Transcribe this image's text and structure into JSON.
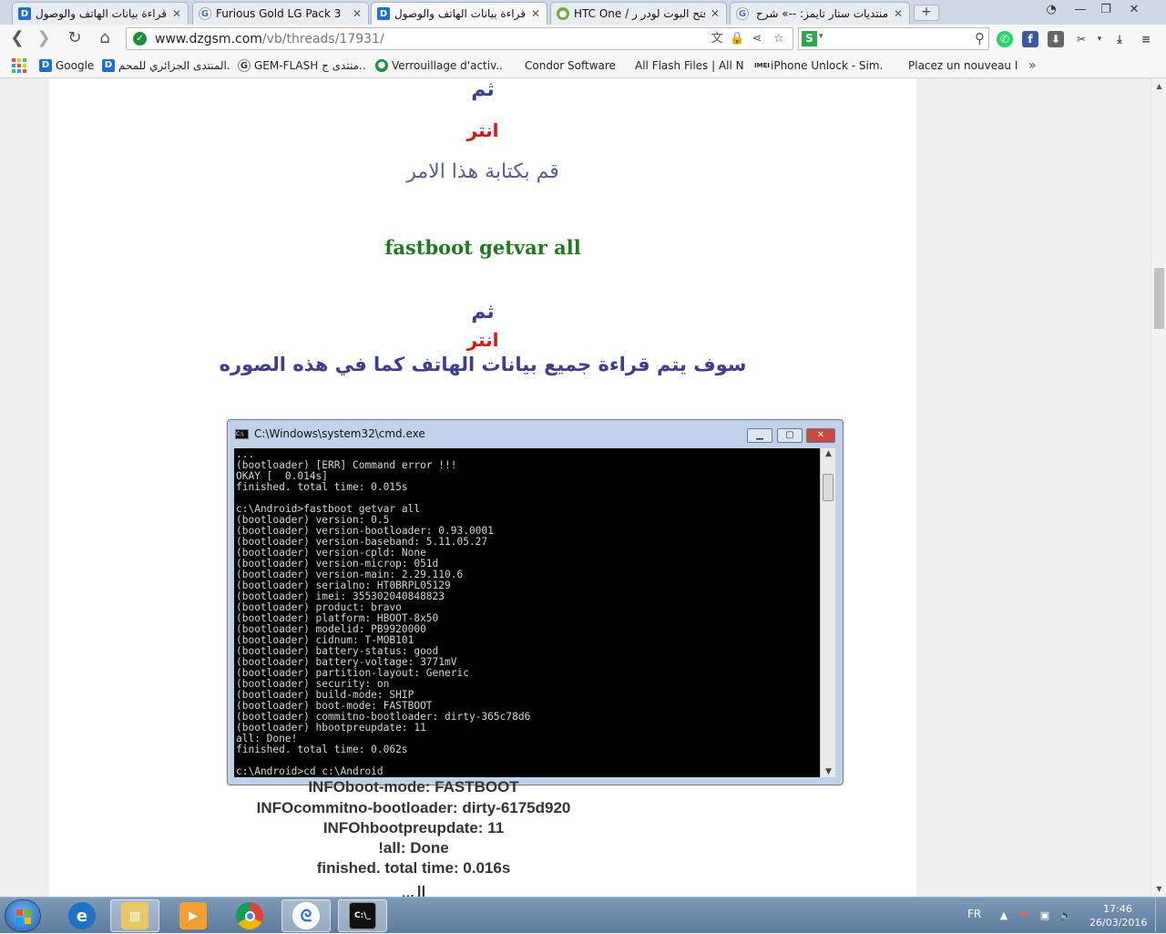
{
  "browser": {
    "tabs": [
      {
        "title": "قراءة بيانات الهاتف والوصول ل",
        "icon": "dzgsm-favicon"
      },
      {
        "title": "Furious Gold LG Pack 3",
        "icon": "gemflash-favicon"
      },
      {
        "title": "قراءة بيانات الهاتف والوصول ل",
        "icon": "dzgsm-favicon",
        "active": true
      },
      {
        "title": "HTC One / فتح البوت لودر ر",
        "icon": "htc-favicon"
      },
      {
        "title": "منتديات ستار تايمز: --» شرح",
        "icon": "google-favicon"
      }
    ],
    "new_tab_label": "+",
    "url_host": "www.dzgsm.com",
    "url_path": "/vb/threads/17931/",
    "search_value": "",
    "bookmarks": [
      {
        "label": "Google",
        "icon": "dzgsm-favicon"
      },
      {
        "label": "المنتدى الجزائري للمحم...",
        "icon": "dzgsm-favicon"
      },
      {
        "label": "GEM-FLASH منتدى ج...",
        "icon": "gemflash-favicon"
      },
      {
        "label": "Verrouillage d'activ...",
        "icon": "green-circle-favicon"
      },
      {
        "label": "Condor Software",
        "icon": ""
      },
      {
        "label": "All Flash Files | All N...",
        "icon": ""
      },
      {
        "label": "iPhone Unlock - Sim...",
        "icon": "imei-favicon"
      },
      {
        "label": "Placez un nouveau I...",
        "icon": ""
      }
    ],
    "more_bookmarks": "»"
  },
  "article": {
    "then1": "ثم",
    "enter1": "انتر",
    "type_command": "قم بكتابة هذا الامر",
    "command": "fastboot getvar all",
    "then2": "ثم",
    "enter2": "انتر",
    "read_all": "سوف يتم قراءة جميع بيانات الهاتف كما في هذه الصوره",
    "info_lines": [
      "INFOboot-mode: FASTBOOT",
      "INFOcommitno-bootloader: dirty-6175d920",
      "INFOhbootpreupdate: 11",
      "!all: Done",
      "finished. total time: 0.016s"
    ],
    "trailing": "ال.."
  },
  "cmd_window": {
    "title": "C:\\Windows\\system32\\cmd.exe",
    "console_text": "...\n(bootloader) [ERR] Command error !!!\nOKAY [  0.014s]\nfinished. total time: 0.015s\n\nc:\\Android>fastboot getvar all\n(bootloader) version: 0.5\n(bootloader) version-bootloader: 0.93.0001\n(bootloader) version-baseband: 5.11.05.27\n(bootloader) version-cpld: None\n(bootloader) version-microp: 051d\n(bootloader) version-main: 2.29.110.6\n(bootloader) serialno: HT0BRPL05129\n(bootloader) imei: 355302040848823\n(bootloader) product: bravo\n(bootloader) platform: HBOOT-8x50\n(bootloader) modelid: PB9920000\n(bootloader) cidnum: T-MOB101\n(bootloader) battery-status: good\n(bootloader) battery-voltage: 3771mV\n(bootloader) partition-layout: Generic\n(bootloader) security: on\n(bootloader) build-mode: SHIP\n(bootloader) boot-mode: FASTBOOT\n(bootloader) commitno-bootloader: dirty-365c78d6\n(bootloader) hbootpreupdate: 11\nall: Done!\nfinished. total time: 0.062s\n\nc:\\Android>cd c:\\Android"
  },
  "taskbar": {
    "language": "FR",
    "time": "17:46",
    "date": "26/03/2016"
  },
  "colors": {
    "then": "#3c3f8f",
    "enter": "#e01010",
    "command": "#1f7a1f",
    "page_bg": "#efefef",
    "taskbar": "#6b88a8"
  }
}
